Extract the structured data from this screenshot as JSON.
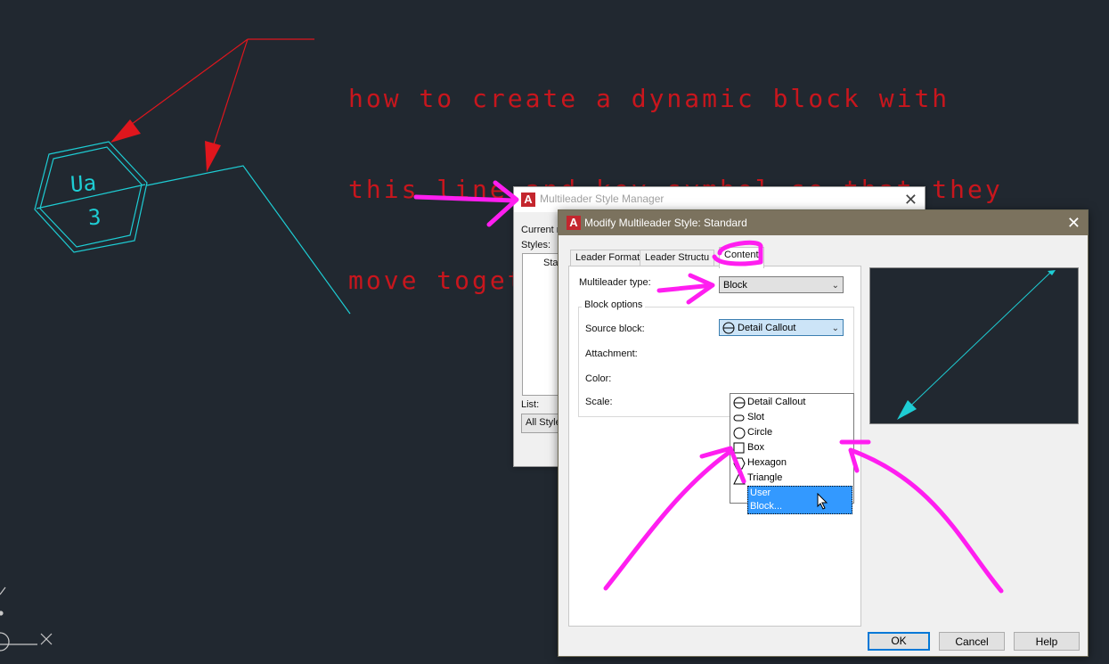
{
  "annotation": {
    "lines": [
      "how to create a dynamic block with",
      "this line and key symbol so that they",
      "move together?"
    ]
  },
  "drawing": {
    "symbol_top_text": "Ua",
    "symbol_bottom_text": "3"
  },
  "manager_dialog": {
    "title": "Multileader Style Manager",
    "current_label": "Current m",
    "styles_label": "Styles:",
    "style_item": "Star",
    "list_label": "List:",
    "list_value": "All Style"
  },
  "modify_dialog": {
    "title": "Modify Multileader Style: Standard",
    "tabs": [
      "Leader Format",
      "Leader Structu",
      "Content"
    ],
    "multileader_type_label": "Multileader type:",
    "multileader_type_value": "Block",
    "block_options_label": "Block options",
    "source_block_label": "Source block:",
    "source_block_value": "Detail Callout",
    "attachment_label": "Attachment:",
    "color_label": "Color:",
    "scale_label": "Scale:",
    "dropdown_options": [
      {
        "label": "Detail Callout",
        "icon": "detail-callout-icon"
      },
      {
        "label": "Slot",
        "icon": "slot-icon"
      },
      {
        "label": "Circle",
        "icon": "circle-icon"
      },
      {
        "label": "Box",
        "icon": "box-icon"
      },
      {
        "label": "Hexagon",
        "icon": "hexagon-icon"
      },
      {
        "label": "Triangle",
        "icon": "triangle-icon"
      },
      {
        "label": "User Block...",
        "icon": "",
        "highlighted": true
      }
    ],
    "buttons": {
      "ok": "OK",
      "cancel": "Cancel",
      "help": "Help"
    }
  },
  "colors": {
    "canvas": "#212830",
    "cad_cyan": "#1ecdd4",
    "annotation_red": "#c8161d",
    "markup_magenta": "#ff1ef0",
    "titlebar_active": "#7b725e"
  }
}
